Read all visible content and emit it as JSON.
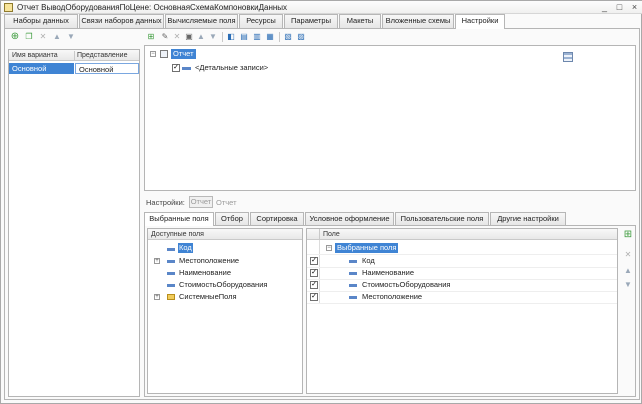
{
  "window": {
    "title": "Отчет ВыводОборудованияПоЦене: ОсновнаяСхемаКомпоновкиДанных",
    "buttons": [
      "_",
      "□",
      "×"
    ]
  },
  "tabs": [
    {
      "label": "Наборы данных",
      "active": false
    },
    {
      "label": "Связи наборов данных",
      "active": false
    },
    {
      "label": "Вычисляемые поля",
      "active": false
    },
    {
      "label": "Ресурсы",
      "active": false
    },
    {
      "label": "Параметры",
      "active": false
    },
    {
      "label": "Макеты",
      "active": false
    },
    {
      "label": "Вложенные схемы",
      "active": false
    },
    {
      "label": "Настройки",
      "active": true
    }
  ],
  "variants": {
    "columns": [
      "Имя варианта",
      "Представление"
    ],
    "rows": [
      {
        "name": "Основной",
        "presentation": "Основной"
      }
    ]
  },
  "structure": {
    "root": "Отчет",
    "child": "<Детальные записи>"
  },
  "settings": {
    "label": "Настройки:",
    "mode_button": "Отчет",
    "mode_text": "Отчет"
  },
  "subtabs": [
    {
      "label": "Выбранные поля",
      "active": true
    },
    {
      "label": "Отбор",
      "active": false
    },
    {
      "label": "Сортировка",
      "active": false
    },
    {
      "label": "Условное оформление",
      "active": false
    },
    {
      "label": "Пользовательские поля",
      "active": false
    },
    {
      "label": "Другие настройки",
      "active": false
    }
  ],
  "available_fields": {
    "header": "Доступные поля",
    "items": [
      {
        "label": "Код",
        "selected": true,
        "expandable": false,
        "type": "field"
      },
      {
        "label": "Местоположение",
        "selected": false,
        "expandable": true,
        "type": "field"
      },
      {
        "label": "Наименование",
        "selected": false,
        "expandable": false,
        "type": "field"
      },
      {
        "label": "СтоимостьОборудования",
        "selected": false,
        "expandable": false,
        "type": "field"
      },
      {
        "label": "СистемныеПоля",
        "selected": false,
        "expandable": true,
        "type": "folder"
      }
    ]
  },
  "selected_fields": {
    "header": "Поле",
    "root": "Выбранные поля",
    "items": [
      {
        "label": "Код",
        "checked": true
      },
      {
        "label": "Наименование",
        "checked": true
      },
      {
        "label": "СтоимостьОборудования",
        "checked": true
      },
      {
        "label": "Местоположение",
        "checked": true
      }
    ]
  },
  "colors": {
    "selection": "#3f84d4",
    "field_icon": "#5a86c8",
    "folder_icon": "#f1cc5b",
    "add_icon": "#3a9a3a"
  }
}
